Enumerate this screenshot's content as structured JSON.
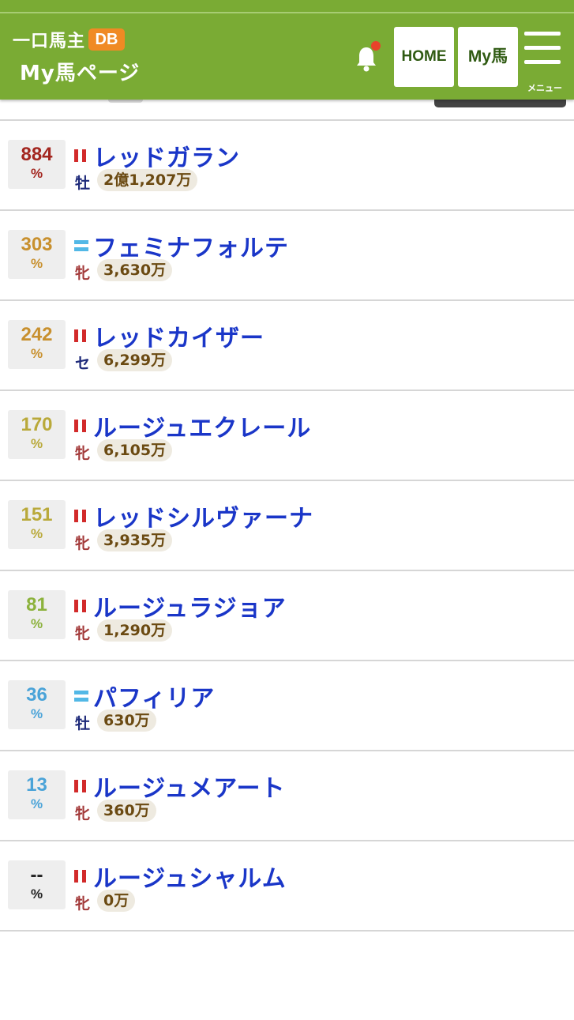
{
  "header": {
    "logo_text": "一口馬主",
    "logo_badge": "DB",
    "page_title": "My馬ページ",
    "home_label": "HOME",
    "my_label": "My馬",
    "menu_label": "メニュー",
    "brand_color": "#7aab34"
  },
  "horses": [
    {
      "pct": "884",
      "pct_color": "#a3261f",
      "silk": "red-bars",
      "name": "レッドガラン",
      "sex": "牡",
      "sex_color": "#1e2a7a",
      "prize": "2億1,207万"
    },
    {
      "pct": "303",
      "pct_color": "#c8902e",
      "silk": "blue-lines",
      "name": "フェミナフォルテ",
      "sex": "牝",
      "sex_color": "#a33a3a",
      "prize": "3,630万"
    },
    {
      "pct": "242",
      "pct_color": "#c8902e",
      "silk": "red-bars",
      "name": "レッドカイザー",
      "sex": "セ",
      "sex_color": "#1e2a7a",
      "prize": "6,299万"
    },
    {
      "pct": "170",
      "pct_color": "#b9a93a",
      "silk": "red-bars",
      "name": "ルージュエクレール",
      "sex": "牝",
      "sex_color": "#a33a3a",
      "prize": "6,105万"
    },
    {
      "pct": "151",
      "pct_color": "#b9a93a",
      "silk": "red-bars",
      "name": "レッドシルヴァーナ",
      "sex": "牝",
      "sex_color": "#a33a3a",
      "prize": "3,935万"
    },
    {
      "pct": "81",
      "pct_color": "#8cb23c",
      "silk": "red-bars",
      "name": "ルージュラジョア",
      "sex": "牝",
      "sex_color": "#a33a3a",
      "prize": "1,290万"
    },
    {
      "pct": "36",
      "pct_color": "#4aa3d8",
      "silk": "blue-lines",
      "name": "パフィリア",
      "sex": "牡",
      "sex_color": "#1e2a7a",
      "prize": "630万"
    },
    {
      "pct": "13",
      "pct_color": "#4aa3d8",
      "silk": "red-bars",
      "name": "ルージュメアート",
      "sex": "牝",
      "sex_color": "#a33a3a",
      "prize": "360万"
    },
    {
      "pct": "--",
      "pct_color": "#222222",
      "silk": "red-bars",
      "name": "ルージュシャルム",
      "sex": "牝",
      "sex_color": "#a33a3a",
      "prize": "0万"
    }
  ],
  "pct_sign": "%"
}
